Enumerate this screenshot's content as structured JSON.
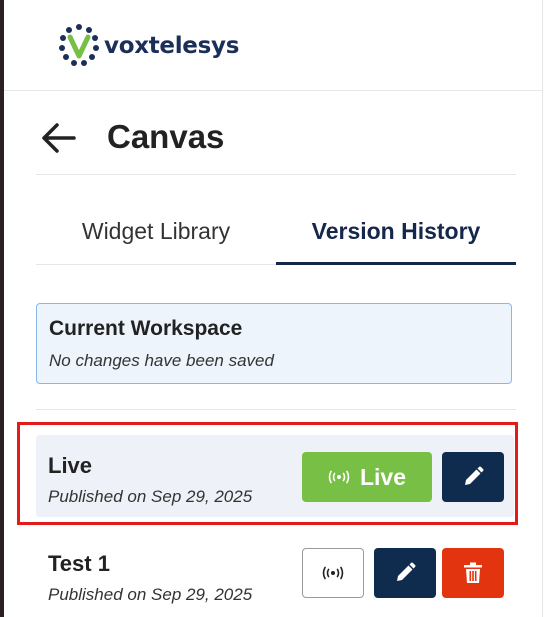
{
  "brand": {
    "name": "voxtelesys",
    "logo_color": "#1b2f58"
  },
  "header": {
    "title": "Canvas",
    "back_icon": "arrow-left-icon"
  },
  "tabs": [
    {
      "label": "Widget Library",
      "active": false
    },
    {
      "label": "Version History",
      "active": true
    }
  ],
  "workspace": {
    "title": "Current Workspace",
    "subtitle": "No changes have been saved"
  },
  "versions": [
    {
      "name": "Live",
      "published": "Published on Sep 29, 2025",
      "status_label": "Live",
      "is_live": true,
      "highlighted": true
    },
    {
      "name": "Test 1",
      "published": "Published on Sep 29, 2025",
      "is_live": false,
      "highlighted": false
    }
  ],
  "colors": {
    "accent_navy": "#0f2b4d",
    "live_green": "#77bf45",
    "delete_red": "#e2340f",
    "highlight_red": "#e21a1a"
  }
}
